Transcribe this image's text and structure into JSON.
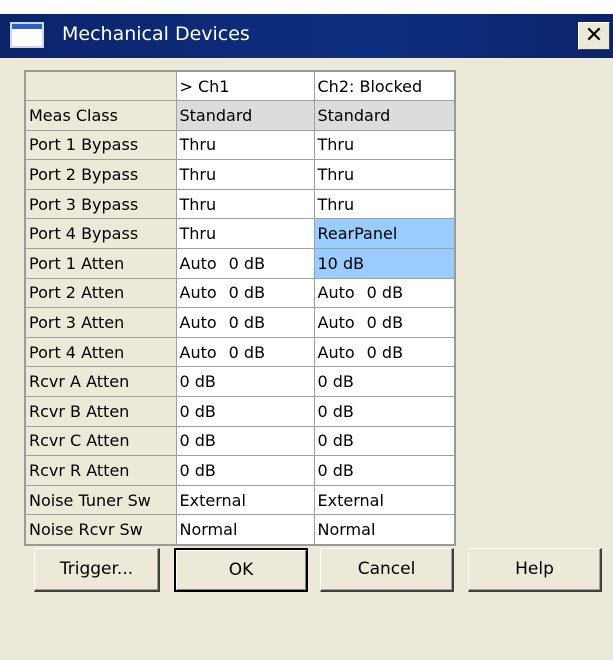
{
  "window": {
    "title": "Mechanical Devices",
    "close_glyph": "✕"
  },
  "grid": {
    "headers": [
      "",
      "> Ch1",
      "Ch2: Blocked"
    ],
    "rows": [
      {
        "label": "Meas Class",
        "ch1": "Standard",
        "ch2": "Standard"
      },
      {
        "label": "Port 1 Bypass",
        "ch1": "Thru",
        "ch2": "Thru"
      },
      {
        "label": "Port 2 Bypass",
        "ch1": "Thru",
        "ch2": "Thru"
      },
      {
        "label": "Port 3 Bypass",
        "ch1": "Thru",
        "ch2": "Thru"
      },
      {
        "label": "Port 4 Bypass",
        "ch1": "Thru",
        "ch2": "RearPanel"
      },
      {
        "label": "Port 1 Atten",
        "ch1_mode": "Auto",
        "ch1_value": "0 dB",
        "ch2_value": "10 dB"
      },
      {
        "label": "Port 2 Atten",
        "ch1_mode": "Auto",
        "ch1_value": "0 dB",
        "ch2_mode": "Auto",
        "ch2_value": "0 dB"
      },
      {
        "label": "Port 3 Atten",
        "ch1_mode": "Auto",
        "ch1_value": "0 dB",
        "ch2_mode": "Auto",
        "ch2_value": "0 dB"
      },
      {
        "label": "Port 4 Atten",
        "ch1_mode": "Auto",
        "ch1_value": "0 dB",
        "ch2_mode": "Auto",
        "ch2_value": "0 dB"
      },
      {
        "label": "Rcvr A Atten",
        "ch1": "0 dB",
        "ch2": "0 dB"
      },
      {
        "label": "Rcvr B Atten",
        "ch1": "0 dB",
        "ch2": "0 dB"
      },
      {
        "label": "Rcvr C Atten",
        "ch1": "0 dB",
        "ch2": "0 dB"
      },
      {
        "label": "Rcvr R Atten",
        "ch1": "0 dB",
        "ch2": "0 dB"
      },
      {
        "label": "Noise Tuner Sw",
        "ch1": "External",
        "ch2": "External"
      },
      {
        "label": "Noise Rcvr Sw",
        "ch1": "Normal",
        "ch2": "Normal"
      }
    ]
  },
  "buttons": {
    "trigger": "Trigger...",
    "ok": "OK",
    "cancel": "Cancel",
    "help": "Help"
  },
  "colors": {
    "titlebar": "#0a246a",
    "dialog": "#ece9d8",
    "selected_cell": "#99ccff",
    "disabled_cell": "#dcdcdc"
  },
  "icons": {
    "window_icon": "window-icon",
    "close": "close-icon"
  }
}
